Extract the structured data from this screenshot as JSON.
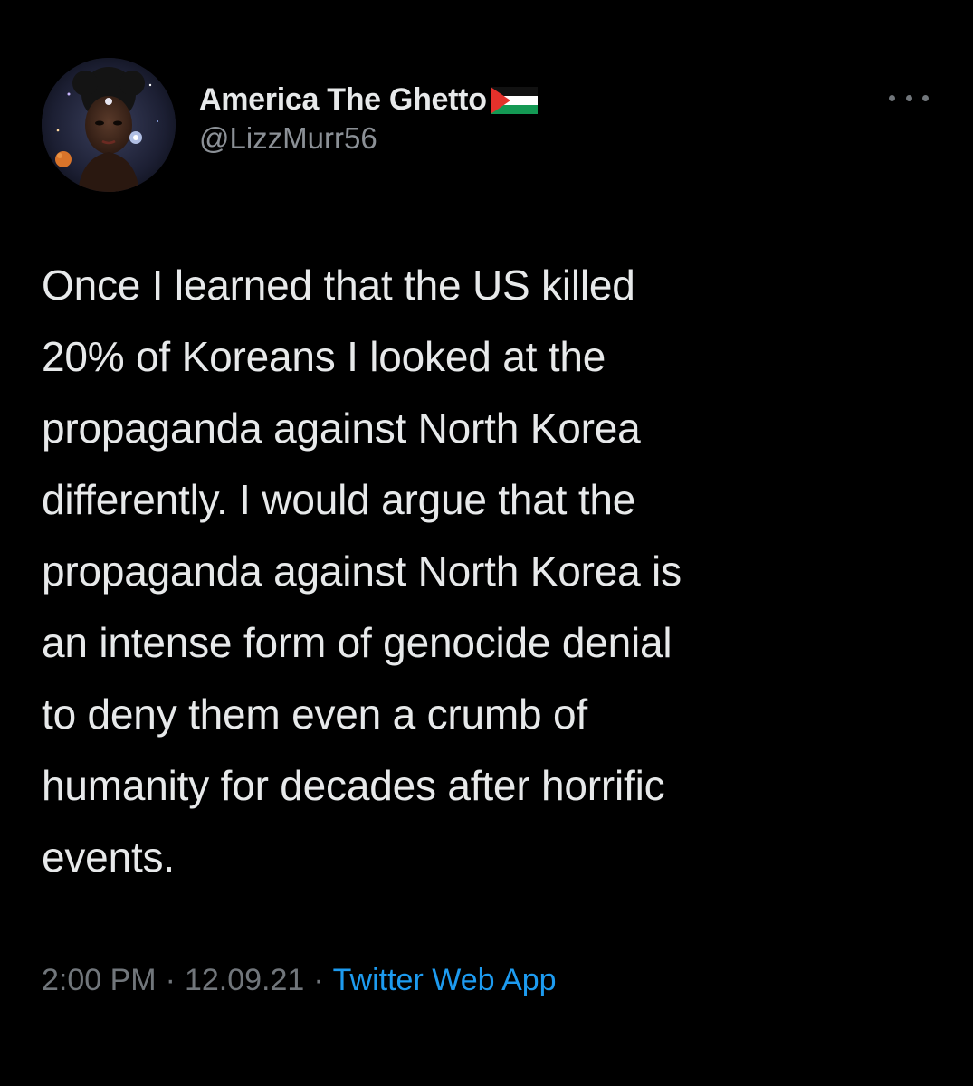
{
  "author": {
    "display_name": "America The Ghetto",
    "handle": "@LizzMurr56",
    "avatar_icon": "profile-avatar-portrait",
    "badge_icon": "palestine-flag-icon"
  },
  "menu": {
    "more_icon": "more-options-icon"
  },
  "tweet": {
    "text": "Once I learned that the US killed\n20% of Koreans I looked at the\npropaganda  against North Korea\ndifferently. I would argue that the\npropaganda against North Korea is\nan intense form of genocide denial\nto deny them even a crumb of\nhumanity for decades after horrific\nevents."
  },
  "meta": {
    "time": "2:00 PM",
    "separator": "·",
    "date": "12.09.21",
    "source": "Twitter Web App"
  },
  "colors": {
    "background": "#000000",
    "text_primary": "#e7e9ea",
    "text_secondary": "#71767b",
    "link": "#1d9bf0"
  }
}
